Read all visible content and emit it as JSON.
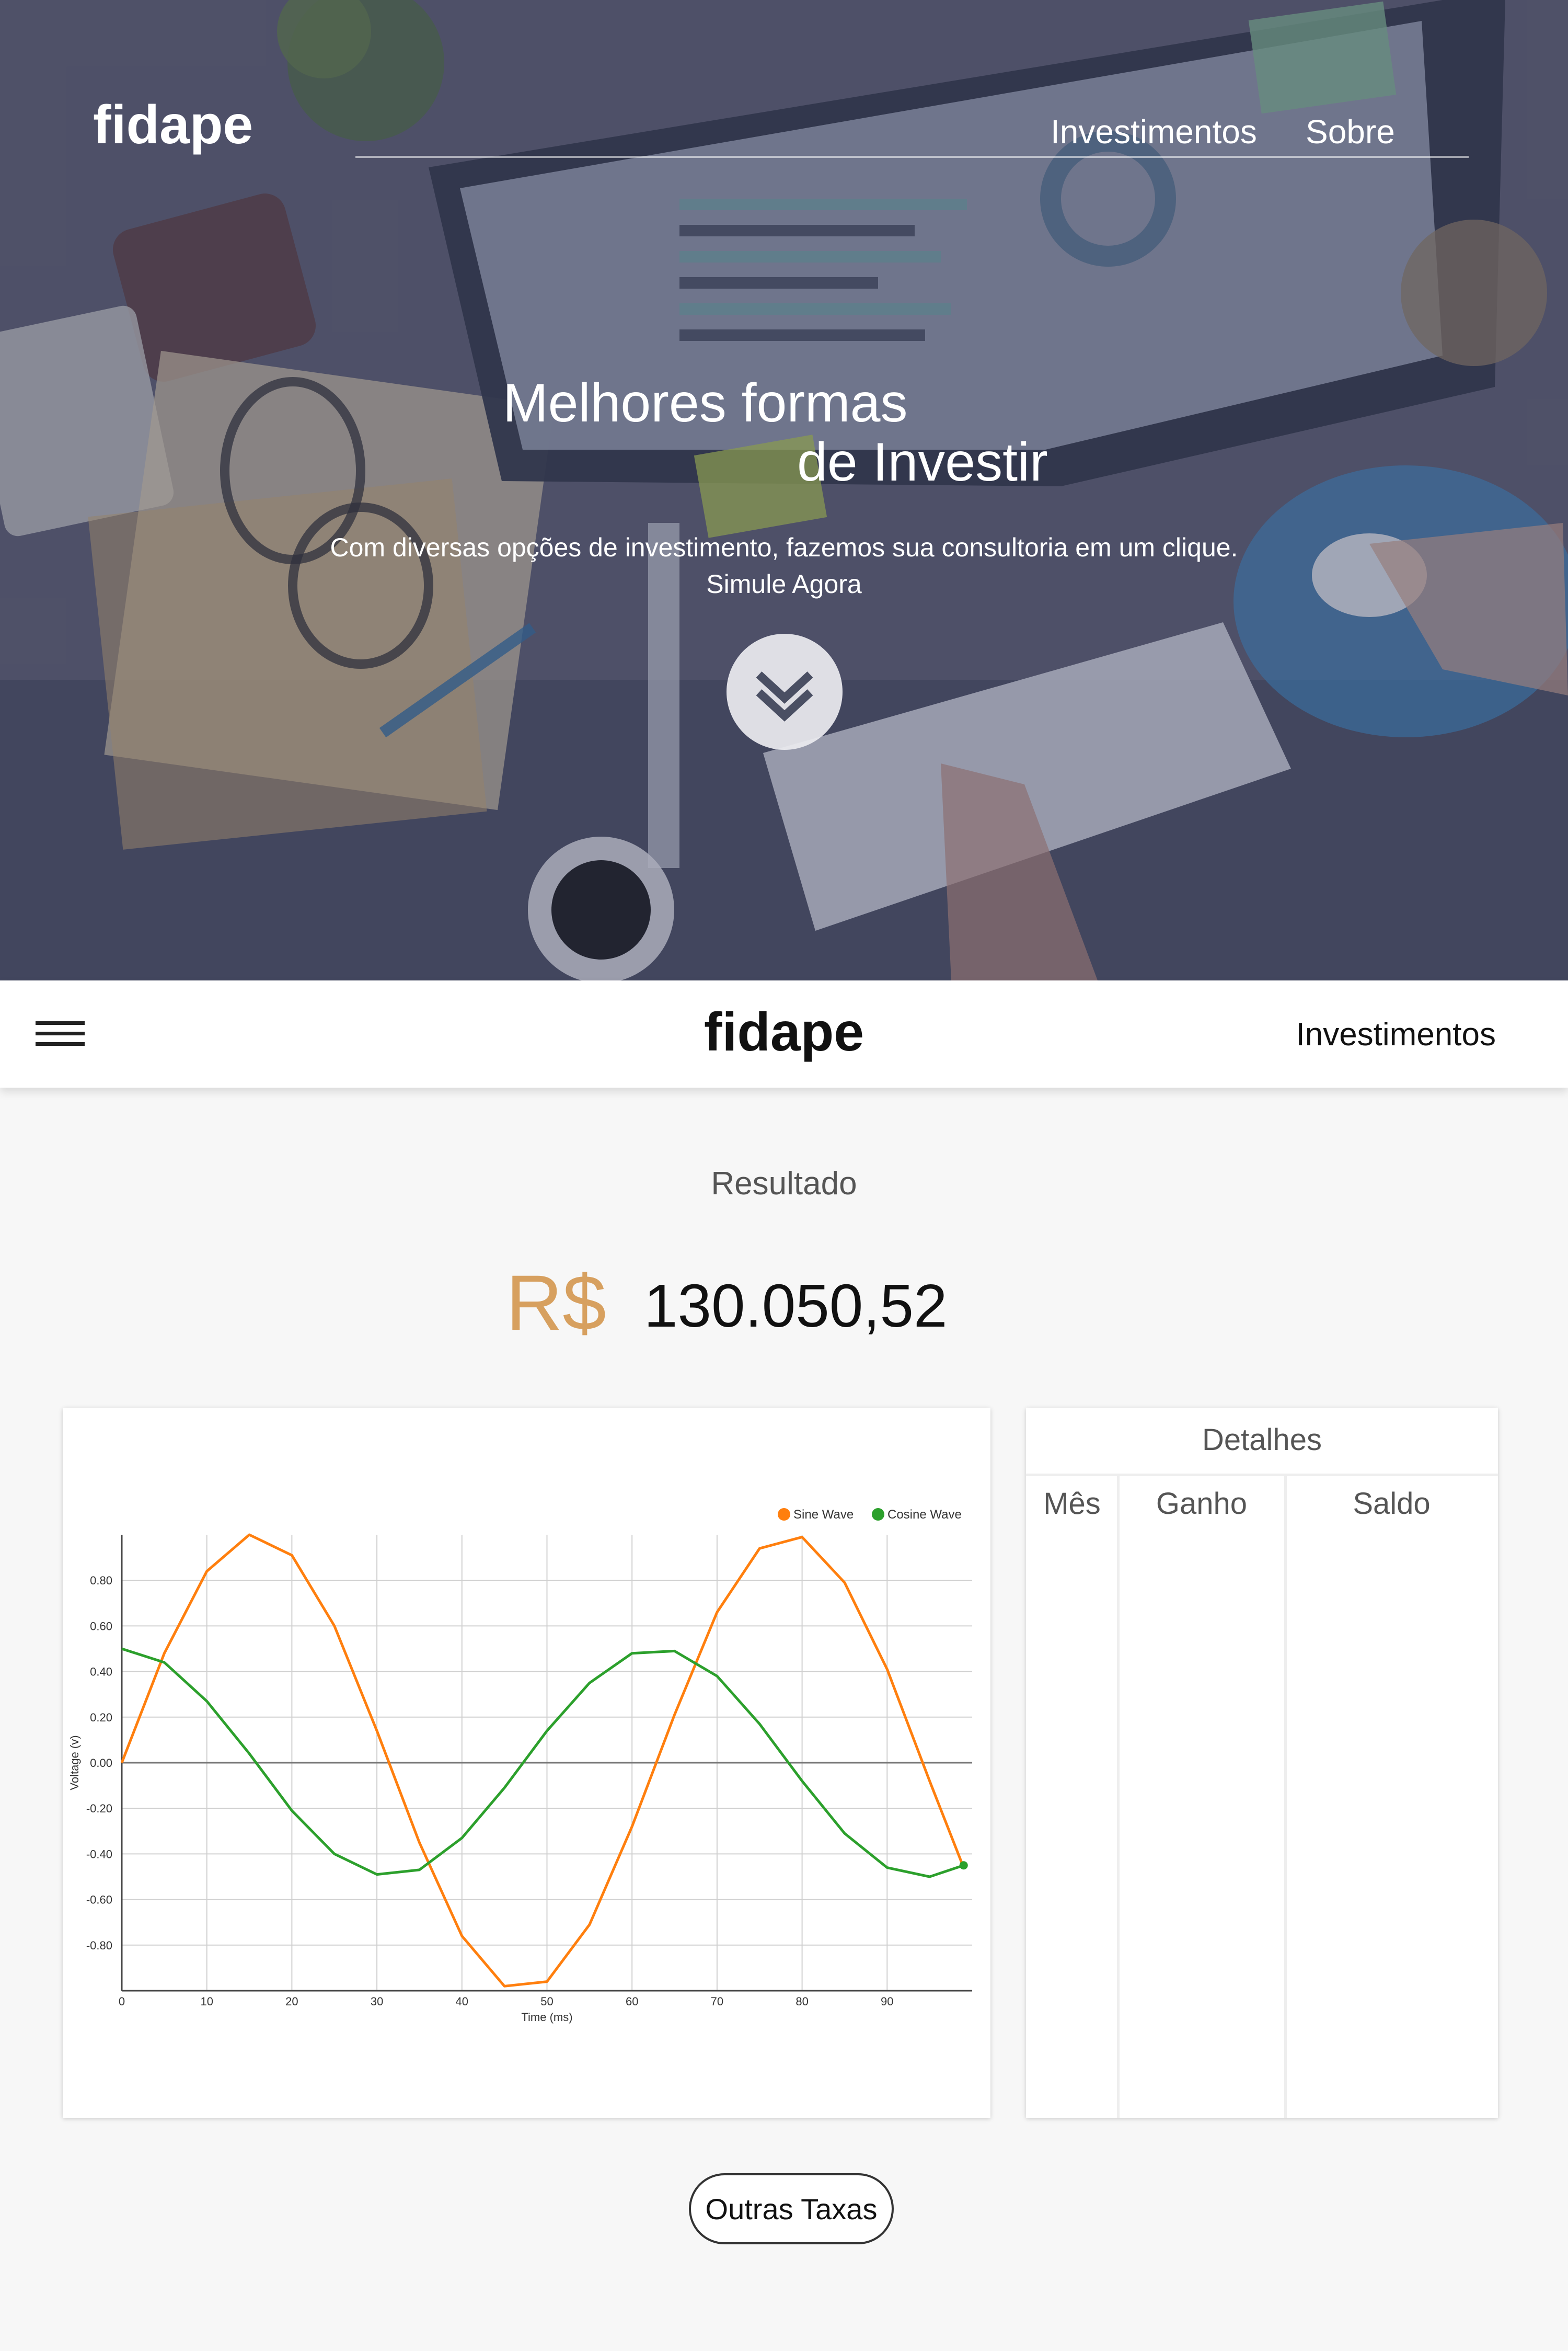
{
  "hero": {
    "logo": "fidape",
    "nav": [
      "Investimentos",
      "Sobre"
    ],
    "title_line1": "Melhores formas",
    "title_line2": "de Investir",
    "subtitle": "Com diversas opções de investimento, fazemos sua consultoria em um clique.",
    "cta": "Simule Agora",
    "scroll_icon": "double-chevron-down-icon"
  },
  "navbar": {
    "menu_icon": "hamburger-menu-icon",
    "logo": "fidape",
    "link": "Investimentos"
  },
  "result": {
    "label": "Resultado",
    "currency": "R$",
    "amount": "130.050,52",
    "currency_color": "#d7a05f"
  },
  "chart_data": {
    "type": "line",
    "title": "",
    "xlabel": "Time (ms)",
    "ylabel": "Voltage (v)",
    "xlim": [
      0,
      100
    ],
    "ylim": [
      -1,
      1
    ],
    "x_ticks": [
      "0",
      "10",
      "20",
      "30",
      "40",
      "50",
      "60",
      "70",
      "80",
      "90"
    ],
    "y_ticks": [
      "0.80",
      "0.60",
      "0.40",
      "0.20",
      "0.00",
      "-0.20",
      "-0.40",
      "-0.60",
      "-0.80"
    ],
    "grid": true,
    "legend_position": "top-right",
    "series": [
      {
        "name": "Sine Wave",
        "color": "#ff7f0e",
        "x": [
          0,
          5,
          10,
          15,
          20,
          25,
          30,
          35,
          40,
          45,
          50,
          55,
          60,
          65,
          70,
          75,
          80,
          85,
          90,
          95,
          99
        ],
        "values": [
          0.0,
          0.48,
          0.84,
          1.0,
          0.91,
          0.6,
          0.14,
          -0.35,
          -0.76,
          -0.98,
          -0.96,
          -0.71,
          -0.28,
          0.21,
          0.66,
          0.94,
          0.99,
          0.79,
          0.41,
          -0.08,
          -0.46
        ]
      },
      {
        "name": "Cosine Wave",
        "color": "#2ca02c",
        "x": [
          0,
          5,
          10,
          15,
          20,
          25,
          30,
          35,
          40,
          45,
          50,
          55,
          60,
          65,
          70,
          75,
          80,
          85,
          90,
          95,
          99
        ],
        "values": [
          0.5,
          0.44,
          0.27,
          0.04,
          -0.21,
          -0.4,
          -0.49,
          -0.47,
          -0.33,
          -0.11,
          0.14,
          0.35,
          0.48,
          0.49,
          0.38,
          0.17,
          -0.08,
          -0.31,
          -0.46,
          -0.5,
          -0.45
        ]
      }
    ]
  },
  "details": {
    "title": "Detalhes",
    "columns": [
      "Mês",
      "Ganho",
      "Saldo"
    ],
    "rows": []
  },
  "footer": {
    "button": "Outras Taxas"
  }
}
